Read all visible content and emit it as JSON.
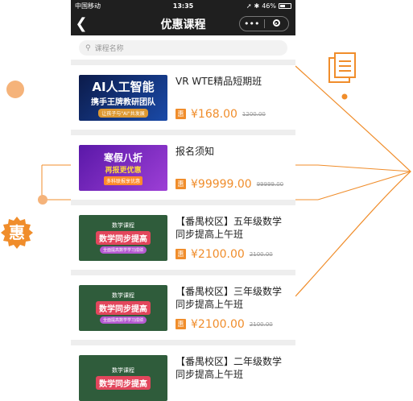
{
  "status_bar": {
    "carrier": "中国移动",
    "time": "13:35",
    "battery": "46%",
    "battery_level": 0.46
  },
  "nav": {
    "title": "优惠课程",
    "more_symbol": "•••"
  },
  "search": {
    "placeholder": "课程名称"
  },
  "badge": {
    "text": "惠"
  },
  "courses": [
    {
      "name": "VR WTE精品短期班",
      "tag": "惠",
      "price": "¥168.00",
      "original": "1200.00",
      "thumb": {
        "line1": "AI人工智能",
        "line2": "携手王牌教研团队",
        "line3": "让孩子与\"AI\"共发展"
      }
    },
    {
      "name": "报名须知",
      "tag": "惠",
      "price": "¥99999.00",
      "original": "99999.00",
      "thumb": {
        "line1": "寒假八折",
        "line2": "再报更优惠",
        "line3": "多科联报享优惠"
      }
    },
    {
      "name": "【番禺校区】五年级数学同步提高上午班",
      "tag": "惠",
      "price": "¥2100.00",
      "original": "2100.00",
      "thumb": {
        "line1": "数学课程",
        "line2": "数学同步提高",
        "line3": "全面提高数学学习成绩"
      }
    },
    {
      "name": "【番禺校区】三年级数学同步提高上午班",
      "tag": "惠",
      "price": "¥2100.00",
      "original": "2100.00",
      "thumb": {
        "line1": "数学课程",
        "line2": "数学同步提高",
        "line3": "全面提高数学学习成绩"
      }
    },
    {
      "name": "【番禺校区】二年级数学同步提高上午班",
      "tag": "惠",
      "price": "",
      "original": "",
      "thumb": {
        "line1": "数学课程",
        "line2": "数学同步提高",
        "line3": ""
      }
    }
  ],
  "colors": {
    "accent": "#f08d2b",
    "navbar": "#1f1f1f"
  }
}
